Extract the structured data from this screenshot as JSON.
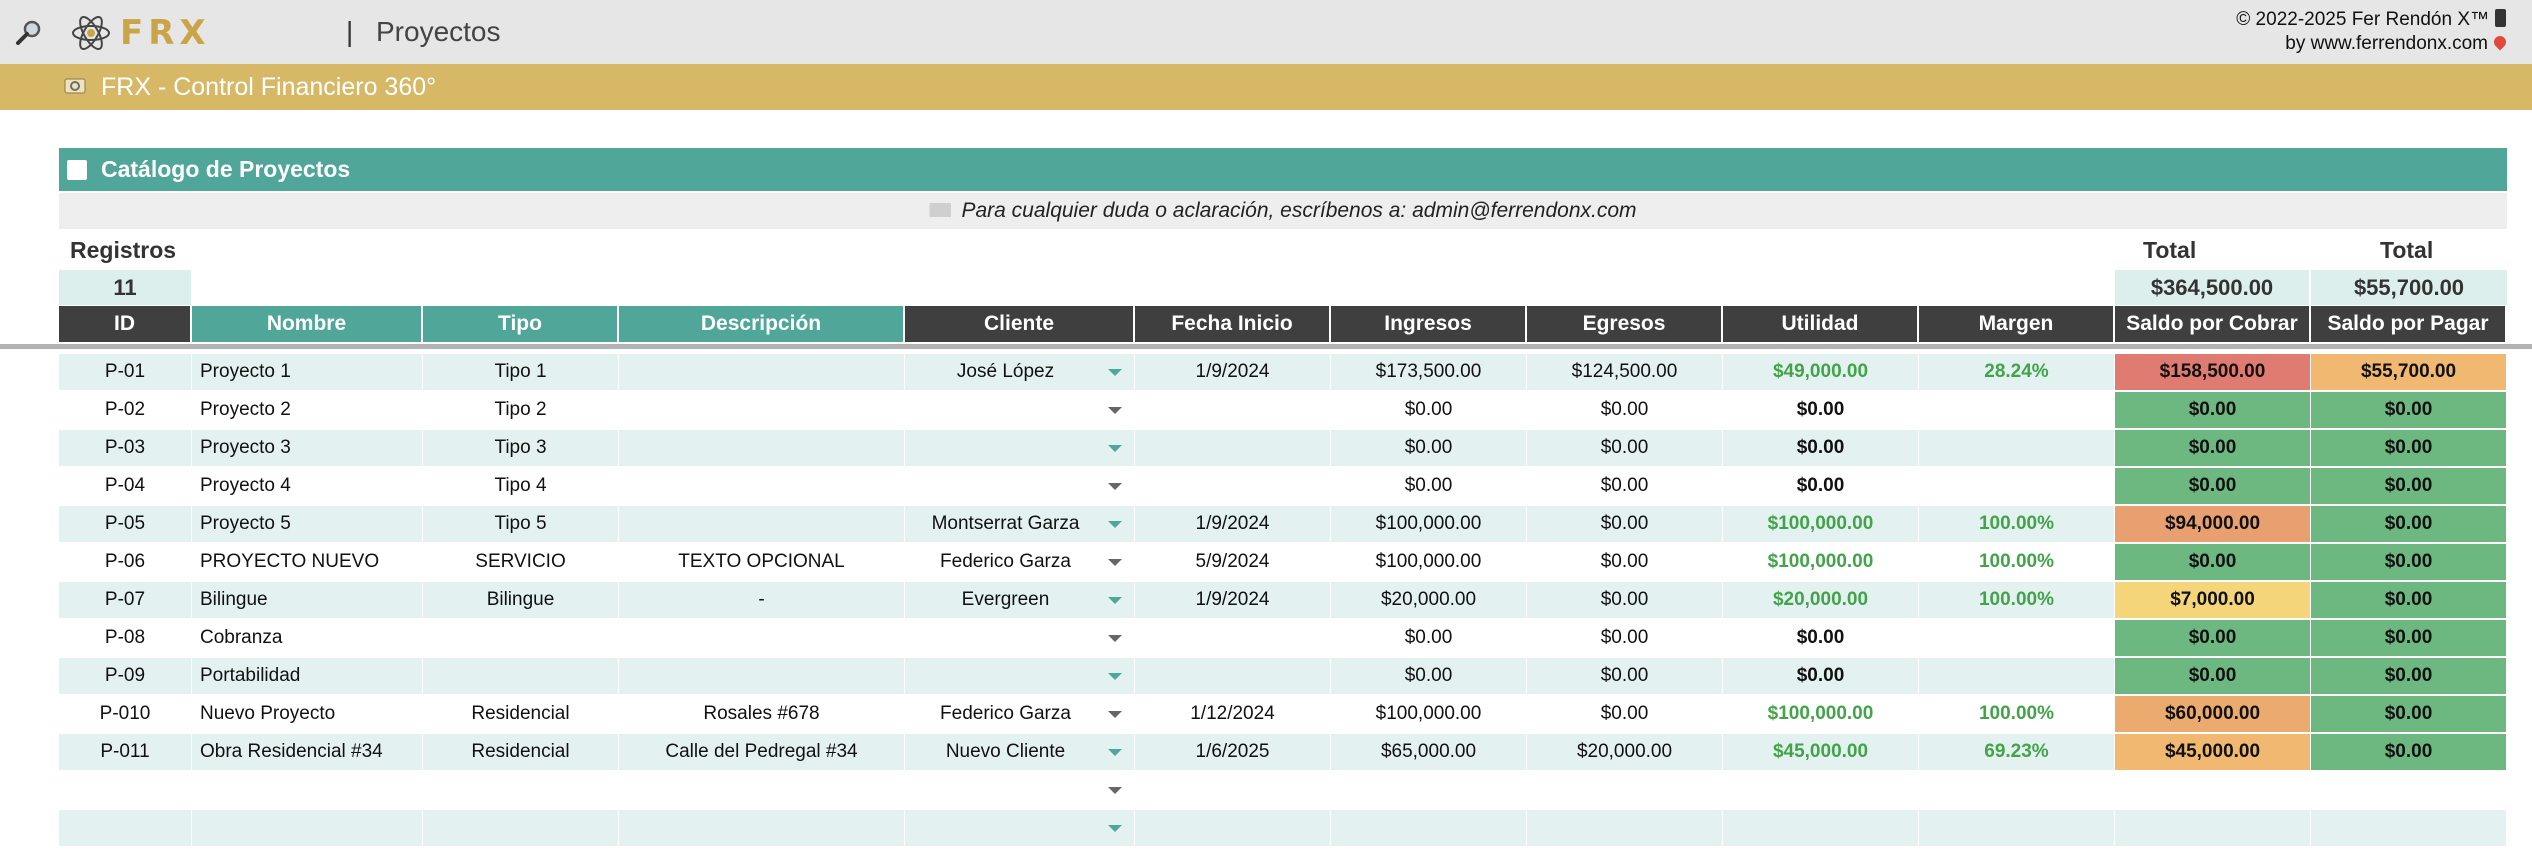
{
  "app": {
    "page_title": "Proyectos",
    "separator": "|",
    "logo_text": "FRX",
    "credit_line1": "© 2022-2025 Fer Rendón X™",
    "credit_line2": "by www.ferrendonx.com",
    "banner_title": "FRX - Control Financiero 360°"
  },
  "catalog": {
    "title": "Catálogo de Proyectos",
    "contact": "Para cualquier duda o aclaración, escríbenos a: admin@ferrendonx.com",
    "registros_label": "Registros",
    "registros_value": "11",
    "total_label_1": "Total",
    "total_value_1": "$364,500.00",
    "total_label_2": "Total",
    "total_value_2": "$55,700.00"
  },
  "columns": [
    "ID",
    "Nombre",
    "Tipo",
    "Descripción",
    "Cliente",
    "Fecha Inicio",
    "Ingresos",
    "Egresos",
    "Utilidad",
    "Margen",
    "Saldo por Cobrar",
    "Saldo por Pagar"
  ],
  "rows": [
    {
      "id": "P-01",
      "nombre": "Proyecto 1",
      "tipo": "Tipo 1",
      "descripcion": "",
      "cliente": "José López",
      "fecha": "1/9/2024",
      "ingresos": "$173,500.00",
      "egresos": "$124,500.00",
      "utilidad": "$49,000.00",
      "margen": "28.24%",
      "cobrar": "$158,500.00",
      "pagar": "$55,700.00",
      "cobrar_color": "#e07b72",
      "pagar_color": "#f0b870",
      "utilidad_pos": true
    },
    {
      "id": "P-02",
      "nombre": "Proyecto 2",
      "tipo": "Tipo 2",
      "descripcion": "",
      "cliente": "",
      "fecha": "",
      "ingresos": "$0.00",
      "egresos": "$0.00",
      "utilidad": "$0.00",
      "margen": "",
      "cobrar": "$0.00",
      "pagar": "$0.00",
      "cobrar_color": "#6cb880",
      "pagar_color": "#6cb880",
      "utilidad_pos": false
    },
    {
      "id": "P-03",
      "nombre": "Proyecto 3",
      "tipo": "Tipo 3",
      "descripcion": "",
      "cliente": "",
      "fecha": "",
      "ingresos": "$0.00",
      "egresos": "$0.00",
      "utilidad": "$0.00",
      "margen": "",
      "cobrar": "$0.00",
      "pagar": "$0.00",
      "cobrar_color": "#6cb880",
      "pagar_color": "#6cb880",
      "utilidad_pos": false
    },
    {
      "id": "P-04",
      "nombre": "Proyecto 4",
      "tipo": "Tipo 4",
      "descripcion": "",
      "cliente": "",
      "fecha": "",
      "ingresos": "$0.00",
      "egresos": "$0.00",
      "utilidad": "$0.00",
      "margen": "",
      "cobrar": "$0.00",
      "pagar": "$0.00",
      "cobrar_color": "#6cb880",
      "pagar_color": "#6cb880",
      "utilidad_pos": false
    },
    {
      "id": "P-05",
      "nombre": "Proyecto 5",
      "tipo": "Tipo 5",
      "descripcion": "",
      "cliente": "Montserrat Garza",
      "fecha": "1/9/2024",
      "ingresos": "$100,000.00",
      "egresos": "$0.00",
      "utilidad": "$100,000.00",
      "margen": "100.00%",
      "cobrar": "$94,000.00",
      "pagar": "$0.00",
      "cobrar_color": "#e8a070",
      "pagar_color": "#6cb880",
      "utilidad_pos": true
    },
    {
      "id": "P-06",
      "nombre": "PROYECTO NUEVO",
      "tipo": "SERVICIO",
      "descripcion": "TEXTO OPCIONAL",
      "cliente": "Federico Garza",
      "fecha": "5/9/2024",
      "ingresos": "$100,000.00",
      "egresos": "$0.00",
      "utilidad": "$100,000.00",
      "margen": "100.00%",
      "cobrar": "$0.00",
      "pagar": "$0.00",
      "cobrar_color": "#6cb880",
      "pagar_color": "#6cb880",
      "utilidad_pos": true
    },
    {
      "id": "P-07",
      "nombre": "Bilingue",
      "tipo": "Bilingue",
      "descripcion": "-",
      "cliente": "Evergreen",
      "fecha": "1/9/2024",
      "ingresos": "$20,000.00",
      "egresos": "$0.00",
      "utilidad": "$20,000.00",
      "margen": "100.00%",
      "cobrar": "$7,000.00",
      "pagar": "$0.00",
      "cobrar_color": "#f5d57a",
      "pagar_color": "#6cb880",
      "utilidad_pos": true
    },
    {
      "id": "P-08",
      "nombre": "Cobranza",
      "tipo": "",
      "descripcion": "",
      "cliente": "",
      "fecha": "",
      "ingresos": "$0.00",
      "egresos": "$0.00",
      "utilidad": "$0.00",
      "margen": "",
      "cobrar": "$0.00",
      "pagar": "$0.00",
      "cobrar_color": "#6cb880",
      "pagar_color": "#6cb880",
      "utilidad_pos": false
    },
    {
      "id": "P-09",
      "nombre": "Portabilidad",
      "tipo": "",
      "descripcion": "",
      "cliente": "",
      "fecha": "",
      "ingresos": "$0.00",
      "egresos": "$0.00",
      "utilidad": "$0.00",
      "margen": "",
      "cobrar": "$0.00",
      "pagar": "$0.00",
      "cobrar_color": "#6cb880",
      "pagar_color": "#6cb880",
      "utilidad_pos": false
    },
    {
      "id": "P-010",
      "nombre": "Nuevo Proyecto",
      "tipo": "Residencial",
      "descripcion": "Rosales #678",
      "cliente": "Federico Garza",
      "fecha": "1/12/2024",
      "ingresos": "$100,000.00",
      "egresos": "$0.00",
      "utilidad": "$100,000.00",
      "margen": "100.00%",
      "cobrar": "$60,000.00",
      "pagar": "$0.00",
      "cobrar_color": "#ecab6e",
      "pagar_color": "#6cb880",
      "utilidad_pos": true
    },
    {
      "id": "P-011",
      "nombre": "Obra Residencial #34",
      "tipo": "Residencial",
      "descripcion": "Calle del Pedregal #34",
      "cliente": "Nuevo Cliente",
      "fecha": "1/6/2025",
      "ingresos": "$65,000.00",
      "egresos": "$20,000.00",
      "utilidad": "$45,000.00",
      "margen": "69.23%",
      "cobrar": "$45,000.00",
      "pagar": "$0.00",
      "cobrar_color": "#f0b870",
      "pagar_color": "#6cb880",
      "utilidad_pos": true
    }
  ],
  "colors": {
    "teal": "#50a699",
    "gold": "#d6b866",
    "dark_header": "#3f3f3f",
    "row_shade": "#e3f2f0",
    "positive_green": "#43a34a"
  },
  "icons": {
    "search": "magnifier-icon",
    "logo": "atom-logo-icon",
    "banner": "gear-icon",
    "catalog": "note-icon",
    "contact": "envelope-icon",
    "dropdown": "chevron-down-icon"
  }
}
